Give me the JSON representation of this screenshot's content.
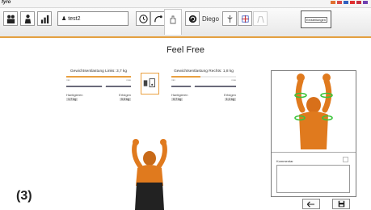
{
  "app": {
    "brand": "fyro"
  },
  "flags": [
    "#e07030",
    "#d84848",
    "#3060c0",
    "#e03030",
    "#c83040",
    "#7040b0"
  ],
  "toolbar": {
    "user_name": "test2",
    "patient_name": "Diego",
    "settings_label": "Einstellungen"
  },
  "main": {
    "title": "Feel Free",
    "left": {
      "title": "Gewichtsentlastung Links: 3,7 kg",
      "min": "min",
      "max": "max",
      "label_left": "Hantigieren",
      "label_right": "Erfolgen",
      "value_left": "1,7 kg",
      "value_right": "3,3 kg",
      "orange_fill": 0.95,
      "gray_fill": 0.55
    },
    "right": {
      "title": "Gewichtsentlastung Rechts: 1,8 kg",
      "min": "min",
      "max": "max",
      "label_left": "Hantigieren",
      "label_right": "Erfolgen",
      "value_left": "0,7 kg",
      "value_right": "1,1 kg",
      "orange_fill": 0.45,
      "gray_fill": 0.3
    }
  },
  "side_panel": {
    "comment_label": "Kommentar"
  },
  "step_label": "(3)",
  "colors": {
    "accent": "#e9a040",
    "skin": "#e07a1e",
    "marker": "#3cc43c"
  }
}
